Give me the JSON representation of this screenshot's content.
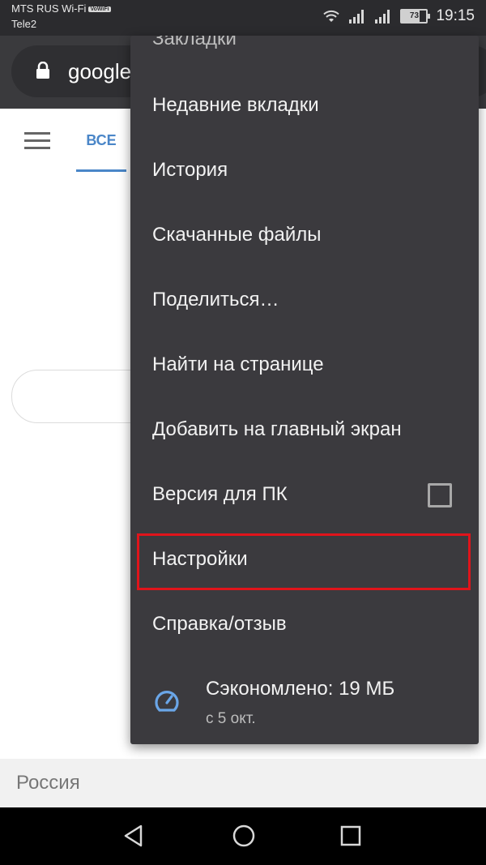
{
  "status_bar": {
    "carrier_primary": "MTS RUS Wi-Fi",
    "wifi_badge": "VoWiFi",
    "carrier_secondary": "Tele2",
    "battery_level": "73",
    "battery_fraction": 0.73,
    "time": "19:15"
  },
  "toolbar": {
    "url": "google"
  },
  "page": {
    "tab_all": "ВСЕ",
    "region": "Россия"
  },
  "menu": {
    "items": [
      "Закладки",
      "Недавние вкладки",
      "История",
      "Скачанные файлы",
      "Поделиться…",
      "Найти на странице",
      "Добавить на главный экран",
      "Версия для ПК",
      "Настройки",
      "Справка/отзыв"
    ],
    "desktop_checked": false,
    "savings_title": "Сэкономлено: 19 МБ",
    "savings_sub": "с 5 окт."
  },
  "colors": {
    "accent_blue": "#4a86c8",
    "highlight_red": "#e0141b",
    "menu_bg": "#3b3a3e"
  }
}
